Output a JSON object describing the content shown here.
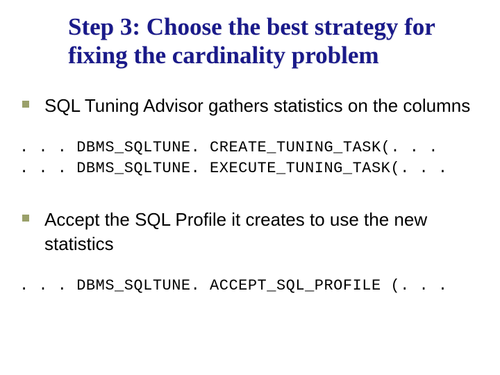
{
  "title": "Step 3:  Choose the best strategy for fixing the cardinality problem",
  "bullets": {
    "b1": "SQL Tuning Advisor gathers statistics on the columns",
    "b2": "Accept the SQL Profile it creates to use the new statistics"
  },
  "code": {
    "c1": ". . . DBMS_SQLTUNE. CREATE_TUNING_TASK(. . .\n. . . DBMS_SQLTUNE. EXECUTE_TUNING_TASK(. . .",
    "c2": ". . . DBMS_SQLTUNE. ACCEPT_SQL_PROFILE (. . ."
  }
}
